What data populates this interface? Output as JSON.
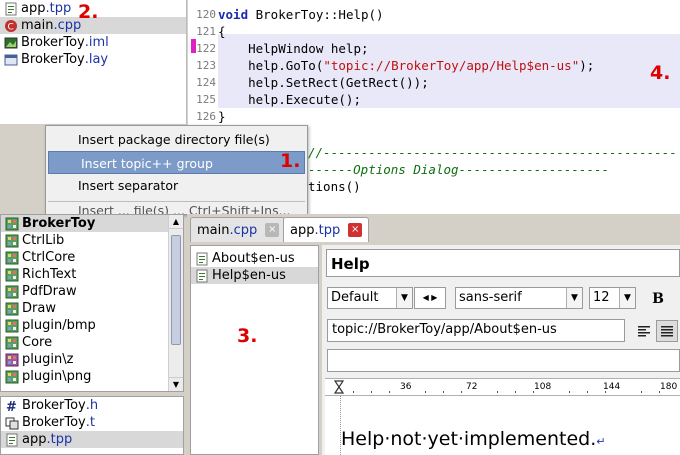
{
  "files_top": [
    {
      "name": "app",
      "ext": ".tpp",
      "icon": "tpp-file-icon"
    },
    {
      "name": "main",
      "ext": ".cpp",
      "icon": "cpp-file-icon"
    },
    {
      "name": "BrokerToy",
      "ext": ".iml",
      "icon": "iml-file-icon"
    },
    {
      "name": "BrokerToy",
      "ext": ".lay",
      "icon": "layout-file-icon"
    }
  ],
  "code": {
    "lines": [
      {
        "n": "120",
        "kw": "void",
        "rest": " BrokerToy::Help()"
      },
      {
        "n": "121",
        "text": "{"
      },
      {
        "n": "122",
        "text": "    HelpWindow help;"
      },
      {
        "n": "123",
        "pre": "    help.GoTo(",
        "str": "\"topic://BrokerToy/app/Help$en-us\"",
        "post": ");"
      },
      {
        "n": "124",
        "text": "    help.SetRect(GetRect());"
      },
      {
        "n": "125",
        "text": "    help.Execute();"
      },
      {
        "n": "126",
        "text": "}"
      }
    ],
    "comment1": "//-----------------------------------------------",
    "comment2_pre": "------",
    "comment2": "Options Dialog",
    "comment2_post": "--------------------",
    "options_line": "tions()"
  },
  "context_menu": {
    "items": [
      "Insert package directory file(s)",
      "Insert topic++ group",
      "Insert separator"
    ],
    "partial": "Insert ... file(s) ... Ctrl+Shift+Ins..."
  },
  "packages": [
    "BrokerToy",
    "CtrlLib",
    "CtrlCore",
    "RichText",
    "PdfDraw",
    "Draw",
    "plugin/bmp",
    "Core",
    "plugin\\z",
    "plugin\\png"
  ],
  "files_bottom": [
    {
      "name": "BrokerToy",
      "ext": ".h",
      "icon": "header-file-icon"
    },
    {
      "name": "BrokerToy",
      "ext": ".t",
      "icon": "translation-file-icon"
    },
    {
      "name": "app",
      "ext": ".tpp",
      "icon": "tpp-file-icon"
    }
  ],
  "tabs": [
    {
      "name": "main",
      "ext": ".cpp",
      "close": "×"
    },
    {
      "name": "app",
      "ext": ".tpp",
      "close": "×"
    }
  ],
  "topics": [
    "About$en-us",
    "Help$en-us"
  ],
  "topic_editor": {
    "title_value": "Help",
    "style": "Default",
    "font": "sans-serif",
    "size": "12",
    "bold": "B",
    "link": "topic://BrokerToy/app/About$en-us",
    "ruler_ticks": [
      "36",
      "72",
      "108",
      "144",
      "180"
    ],
    "body_text": "Help·not·yet·implemented.",
    "paragraph_mark": "↵"
  },
  "annotations": [
    "1.",
    "2.",
    "3.",
    "4."
  ],
  "colors": {
    "annotation": "#e00000",
    "keyword": "#1a2bb0",
    "string": "#c01010",
    "comment": "#107010",
    "menu_highlight": "#7d9bc8",
    "breakpoint": "#e020c0"
  }
}
